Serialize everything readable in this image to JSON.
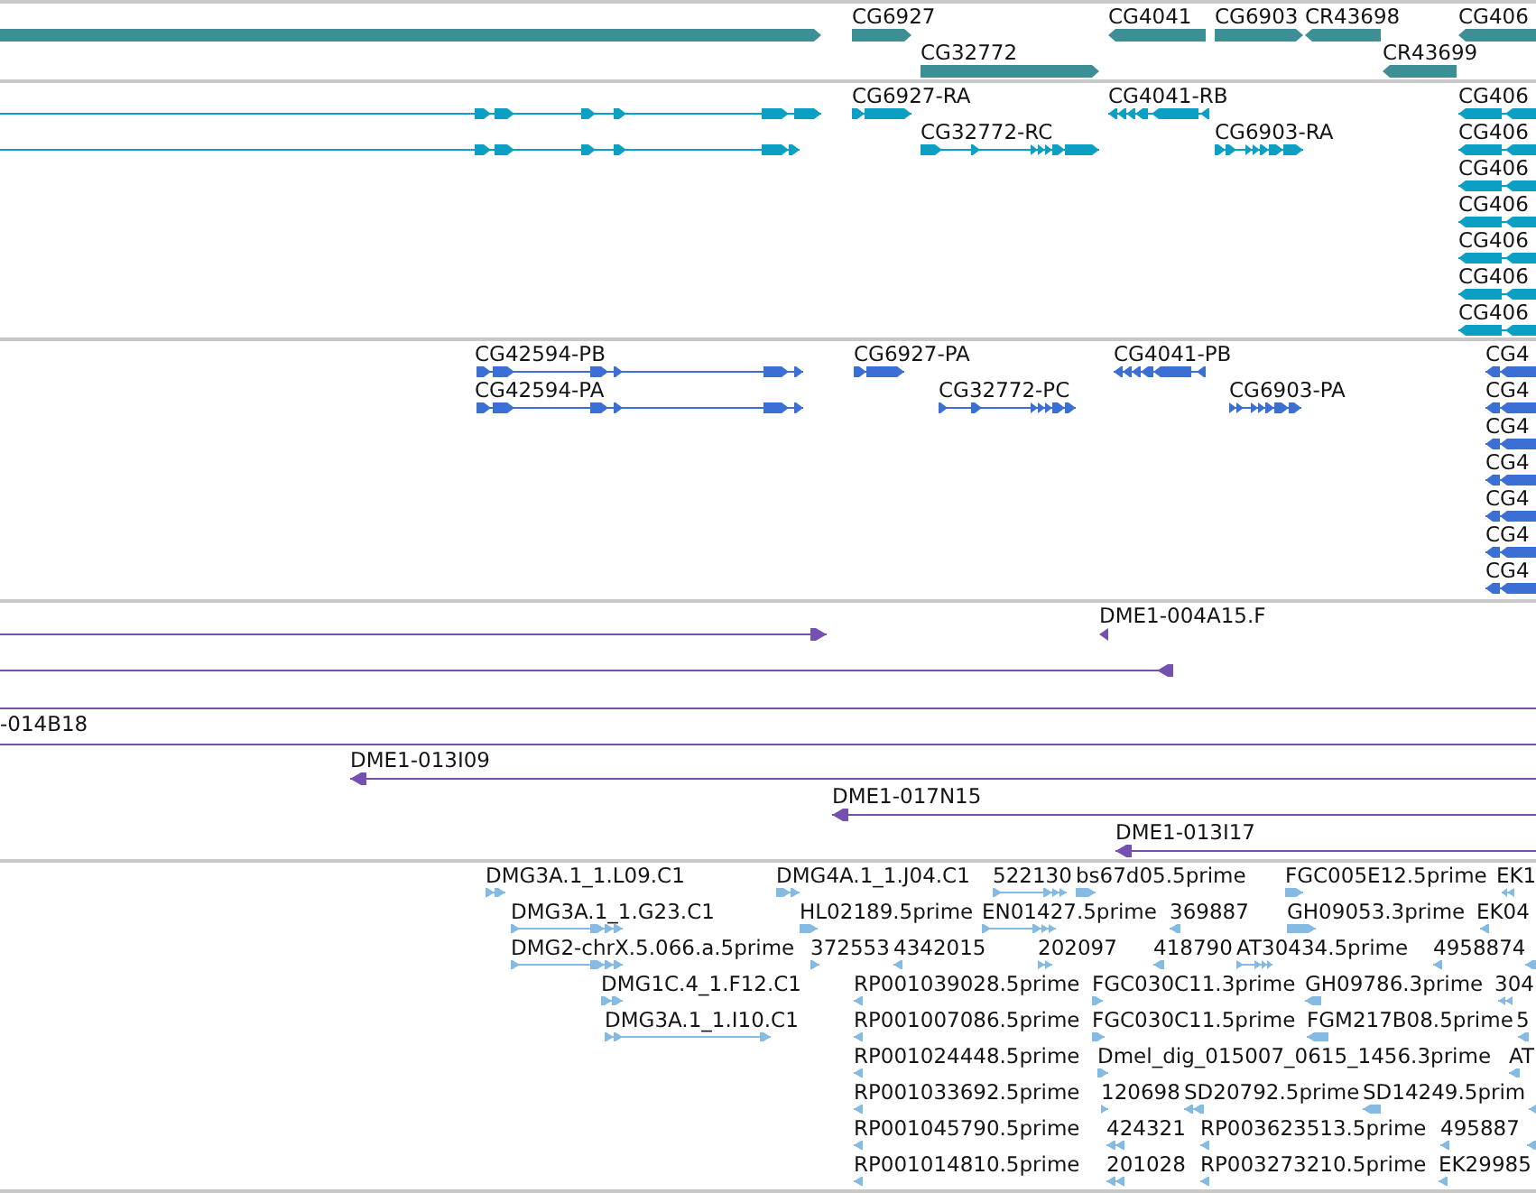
{
  "tracks": [
    {
      "kind": "gene",
      "rows": [
        {
          "features": [
            {
              "reverse": false
            },
            {
              "label": "CG6927",
              "reverse": false
            },
            {
              "label": "CG4041",
              "reverse": true
            },
            {
              "label": "CG6903",
              "reverse": false
            },
            {
              "label": "CR43698",
              "reverse": true
            },
            {
              "label": "CG406",
              "reverse": true
            }
          ]
        },
        {
          "features": [
            {
              "label": "CG32772",
              "reverse": false
            },
            {
              "label": "CR43699",
              "reverse": true
            }
          ]
        }
      ]
    },
    {
      "kind": "transcript",
      "rows": [
        {
          "features": [
            {
              "reverse": false
            },
            {
              "label": "CG6927-RA",
              "reverse": false
            },
            {
              "label": "CG4041-RB",
              "reverse": true
            },
            {
              "label": "CG406",
              "reverse": true
            }
          ]
        },
        {
          "features": [
            {
              "reverse": false
            },
            {
              "label": "CG32772-RC",
              "reverse": false
            },
            {
              "label": "CG6903-RA",
              "reverse": false
            },
            {
              "label": "CG406",
              "reverse": true
            }
          ]
        },
        {
          "features": [
            {
              "label": "CG406",
              "reverse": true
            }
          ]
        },
        {
          "features": [
            {
              "label": "CG406",
              "reverse": true
            }
          ]
        },
        {
          "features": [
            {
              "label": "CG406",
              "reverse": true
            }
          ]
        },
        {
          "features": [
            {
              "label": "CG406",
              "reverse": true
            }
          ]
        },
        {
          "features": [
            {
              "label": "CG406",
              "reverse": true
            }
          ]
        }
      ]
    },
    {
      "kind": "protein",
      "rows": [
        {
          "features": [
            {
              "label": "CG42594-PB",
              "reverse": false
            },
            {
              "label": "CG6927-PA",
              "reverse": false
            },
            {
              "label": "CG4041-PB",
              "reverse": true
            },
            {
              "label": "CG4",
              "reverse": true
            }
          ]
        },
        {
          "features": [
            {
              "label": "CG42594-PA",
              "reverse": false
            },
            {
              "label": "CG32772-PC",
              "reverse": false
            },
            {
              "label": "CG6903-PA",
              "reverse": false
            },
            {
              "label": "CG4",
              "reverse": true
            }
          ]
        },
        {
          "features": [
            {
              "label": "CG4",
              "reverse": true
            }
          ]
        },
        {
          "features": [
            {
              "label": "CG4",
              "reverse": true
            }
          ]
        },
        {
          "features": [
            {
              "label": "CG4",
              "reverse": true
            }
          ]
        },
        {
          "features": [
            {
              "label": "CG4",
              "reverse": true
            }
          ]
        },
        {
          "features": [
            {
              "label": "CG4",
              "reverse": true
            }
          ]
        }
      ]
    },
    {
      "kind": "clone",
      "rows": [
        {
          "features": [
            {
              "reverse": false
            },
            {
              "label": "DME1-004A15.F",
              "reverse": true
            }
          ]
        },
        {
          "features": [
            {
              "reverse": true
            }
          ]
        },
        {
          "full_span": true
        },
        {
          "full_span": true,
          "features": [
            {
              "label": "-014B18"
            }
          ]
        },
        {
          "features": [
            {
              "label": "DME1-013I09",
              "reverse": true
            }
          ]
        },
        {
          "features": [
            {
              "label": "DME1-017N15",
              "reverse": true
            }
          ]
        },
        {
          "features": [
            {
              "label": "DME1-013I17",
              "reverse": true
            }
          ]
        }
      ]
    },
    {
      "kind": "est",
      "rows": [
        {
          "features": [
            {
              "label": "DMG3A.1_1.L09.C1",
              "reverse": false
            },
            {
              "label": "DMG4A.1_1.J04.C1",
              "reverse": false
            },
            {
              "label": "522130",
              "reverse": false
            },
            {
              "label": "bs67d05.5prime",
              "reverse": false
            },
            {
              "label": "FGC005E12.5prime",
              "reverse": false
            },
            {
              "label": "EK1",
              "reverse": true
            }
          ]
        },
        {
          "features": [
            {
              "label": "DMG3A.1_1.G23.C1",
              "reverse": false
            },
            {
              "label": "HL02189.5prime",
              "reverse": false
            },
            {
              "label": "EN01427.5prime",
              "reverse": false
            },
            {
              "label": "369887",
              "reverse": true
            },
            {
              "label": "GH09053.3prime",
              "reverse": false
            },
            {
              "label": "EK04",
              "reverse": true
            }
          ]
        },
        {
          "features": [
            {
              "label": "DMG2-chrX.5.066.a.5prime",
              "reverse": false
            },
            {
              "label": "372553",
              "reverse": false
            },
            {
              "label": "4342015",
              "reverse": true
            },
            {
              "label": "202097",
              "reverse": false
            },
            {
              "label": "418790",
              "reverse": true
            },
            {
              "label": "AT30434.5prime",
              "reverse": false
            },
            {
              "label": "4958874",
              "reverse": true
            },
            {
              "reverse": true
            }
          ]
        },
        {
          "features": [
            {
              "label": "DMG1C.4_1.F12.C1",
              "reverse": false
            },
            {
              "label": "RP001039028.5prime",
              "reverse": true
            },
            {
              "label": "FGC030C11.3prime",
              "reverse": false
            },
            {
              "label": "GH09786.3prime",
              "reverse": true
            },
            {
              "label": "304",
              "reverse": true
            }
          ]
        },
        {
          "features": [
            {
              "label": "DMG3A.1_1.I10.C1",
              "reverse": false
            },
            {
              "label": "RP001007086.5prime",
              "reverse": true
            },
            {
              "label": "FGC030C11.5prime",
              "reverse": false
            },
            {
              "label": "FGM217B08.5prime",
              "reverse": true
            },
            {
              "label": "5",
              "reverse": true
            }
          ]
        },
        {
          "features": [
            {
              "label": "RP001024448.5prime",
              "reverse": true
            },
            {
              "label": "Dmel_dig_015007_0615_1456.3prime",
              "reverse": false
            },
            {
              "label": "AT",
              "reverse": true
            }
          ]
        },
        {
          "features": [
            {
              "label": "RP001033692.5prime",
              "reverse": true
            },
            {
              "label": "120698",
              "reverse": false
            },
            {
              "label": "SD20792.5prime",
              "reverse": true
            },
            {
              "label": "SD14249.5prim",
              "reverse": true
            },
            {
              "reverse": true
            }
          ]
        },
        {
          "features": [
            {
              "label": "RP001045790.5prime",
              "reverse": true
            },
            {
              "label": "424321",
              "reverse": true
            },
            {
              "label": "RP003623513.5prime",
              "reverse": true
            },
            {
              "label": "495887",
              "reverse": true
            },
            {
              "reverse": true
            }
          ]
        },
        {
          "features": [
            {
              "label": "RP001014810.5prime",
              "reverse": true
            },
            {
              "label": "201028",
              "reverse": true
            },
            {
              "label": "RP003273210.5prime",
              "reverse": true
            },
            {
              "label": "EK29985",
              "reverse": true
            }
          ]
        }
      ]
    }
  ]
}
